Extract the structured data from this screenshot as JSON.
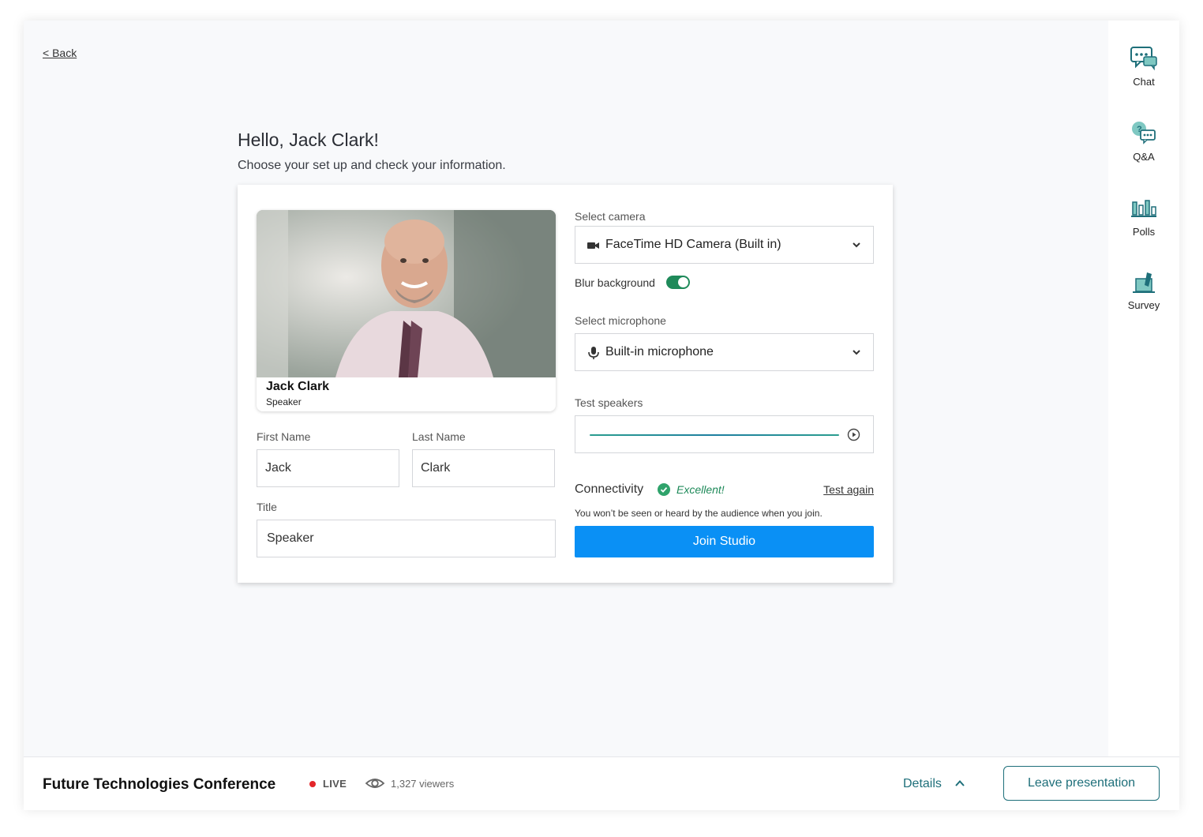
{
  "nav": {
    "back_label": "< Back"
  },
  "rail": {
    "items": [
      {
        "label": "Chat",
        "icon": "chat-icon"
      },
      {
        "label": "Q&A",
        "icon": "qa-icon"
      },
      {
        "label": "Polls",
        "icon": "polls-icon"
      },
      {
        "label": "Survey",
        "icon": "survey-icon"
      }
    ]
  },
  "header": {
    "greeting": "Hello, Jack Clark!",
    "subtitle": "Choose your set up and check your information."
  },
  "preview": {
    "name": "Jack Clark",
    "role": "Speaker"
  },
  "form": {
    "first_name_label": "First Name",
    "first_name_value": "Jack",
    "last_name_label": "Last Name",
    "last_name_value": "Clark",
    "title_label": "Title",
    "title_value": "Speaker"
  },
  "devices": {
    "camera_label": "Select camera",
    "camera_value": "FaceTime HD Camera (Built in)",
    "blur_label": "Blur background",
    "blur_enabled": true,
    "mic_label": "Select microphone",
    "mic_value": "Built-in microphone",
    "speakers_label": "Test speakers"
  },
  "connectivity": {
    "label": "Connectivity",
    "status": "Excellent!",
    "test_again": "Test again",
    "note": "You won’t be seen or heard by the audience when you join."
  },
  "join_label": "Join Studio",
  "footer": {
    "conference": "Future Technologies Conference",
    "live_label": "LIVE",
    "viewers": "1,327 viewers",
    "details_label": "Details",
    "leave_label": "Leave presentation"
  },
  "colors": {
    "accent": "#1e6f7a",
    "primary_button": "#0a90f5",
    "success": "#1f8a5a",
    "live": "#e3262a"
  }
}
